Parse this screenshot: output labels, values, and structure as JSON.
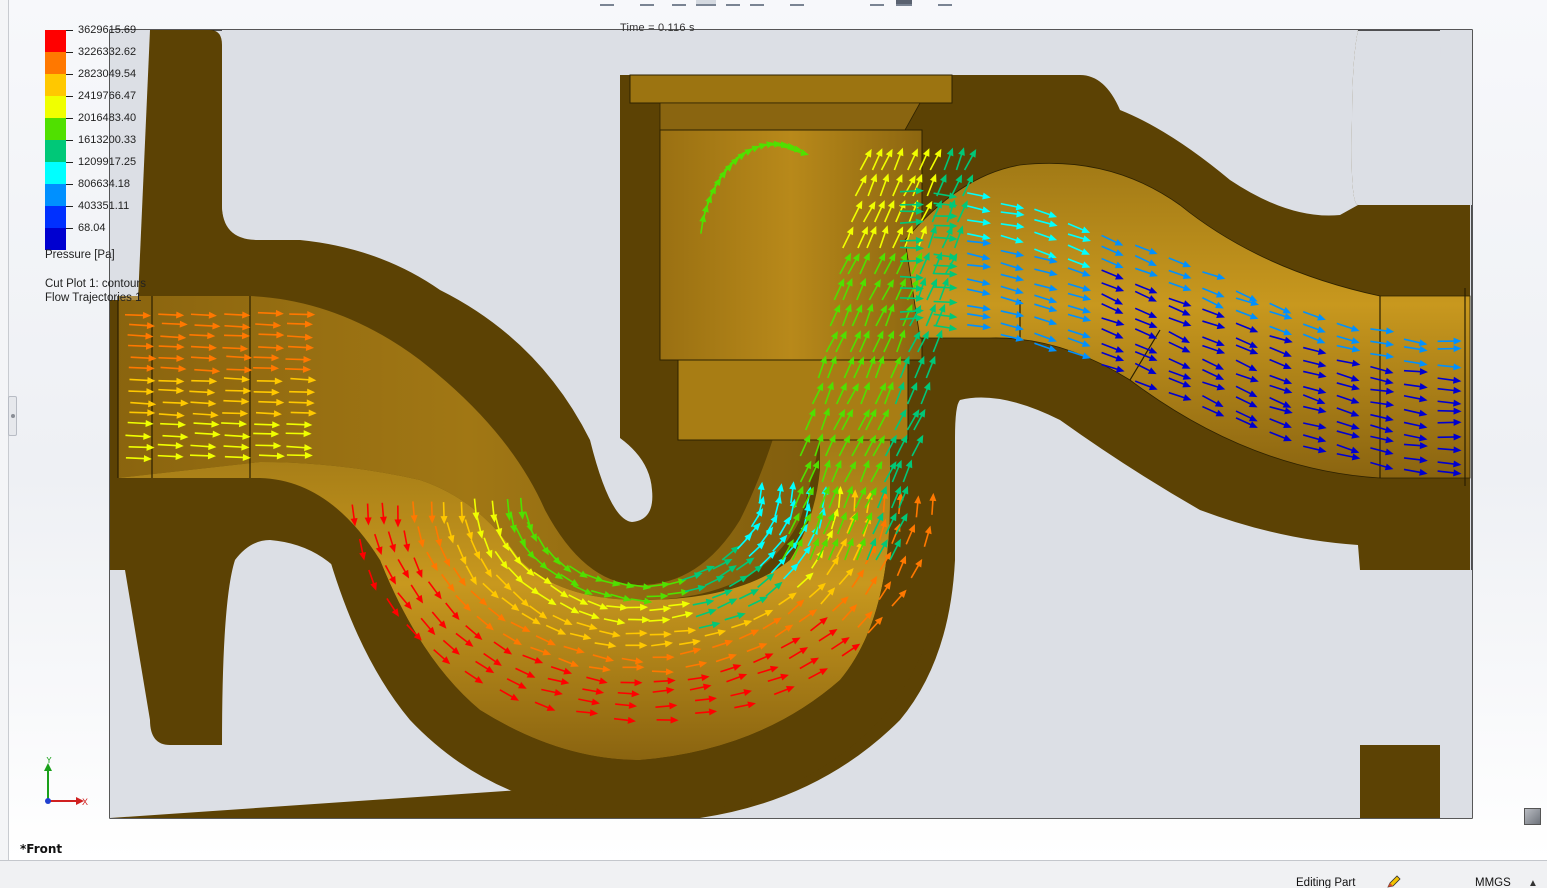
{
  "app": {
    "time_label": "Time = 0.116 s",
    "view_name": "*Front"
  },
  "legend": {
    "title": "Pressure [Pa]",
    "values": [
      "3629615.69",
      "3226332.62",
      "2823049.54",
      "2419766.47",
      "2016483.40",
      "1613200.33",
      "1209917.25",
      "806634.18",
      "403351.11",
      "68.04"
    ],
    "colors": [
      "#ff0000",
      "#ff7800",
      "#ffc800",
      "#f0ff00",
      "#50e000",
      "#00c878",
      "#00ffff",
      "#0090ff",
      "#0030ff",
      "#0000d0"
    ]
  },
  "plots": {
    "cut_plot": "Cut Plot 1: contours",
    "flow_trajectories": "Flow Trajectories 1"
  },
  "triad": {
    "y_label": "Y",
    "x_label": "X"
  },
  "status_bar": {
    "mode": "Editing Part",
    "units": "MMGS",
    "caret": "▲"
  },
  "icons": {
    "triad": "axis-triad-icon",
    "corner": "view-cube-icon",
    "status": "rebuild-pencil-icon"
  }
}
